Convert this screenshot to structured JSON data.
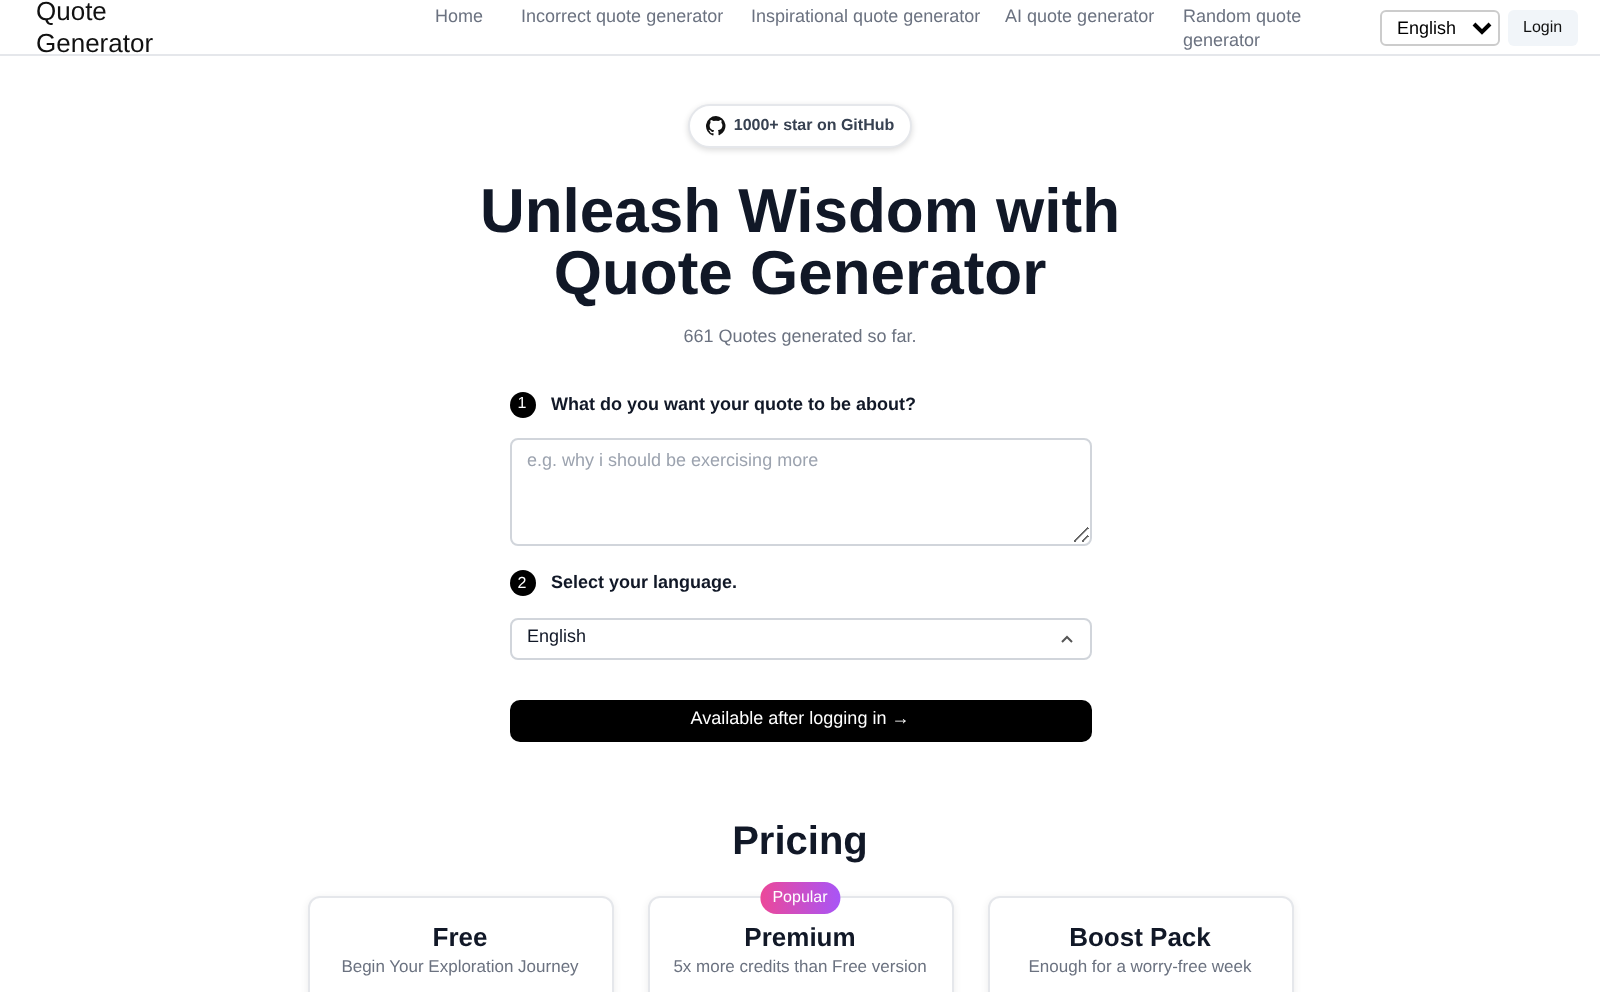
{
  "brand": {
    "name": "Quote Generator"
  },
  "nav": [
    {
      "label": "Home"
    },
    {
      "label": "Incorrect quote generator"
    },
    {
      "label": "Inspirational quote generator"
    },
    {
      "label": "AI quote generator"
    },
    {
      "label": "Random quote generator"
    }
  ],
  "language_select": {
    "value": "English"
  },
  "login": "Login",
  "github_badge": "1000+ star on GitHub",
  "hero": {
    "title": "Unleash Wisdom with Quote Generator",
    "subtitle": "661 Quotes generated so far."
  },
  "steps": [
    {
      "number": "1",
      "label": "What do you want your quote to be about?",
      "kind": "textarea",
      "placeholder": "e.g. why i should be exercising more"
    },
    {
      "number": "2",
      "label": "Select your language.",
      "kind": "select",
      "value": "English"
    }
  ],
  "submit": "Available after logging in →",
  "pricing": {
    "title": "Pricing",
    "plans": [
      {
        "name": "Free",
        "tagline": "Begin Your Exploration Journey"
      },
      {
        "name": "Premium",
        "tagline": "5x more credits than Free version",
        "badge": "Popular"
      },
      {
        "name": "Boost Pack",
        "tagline": "Enough for a worry-free week"
      }
    ]
  }
}
